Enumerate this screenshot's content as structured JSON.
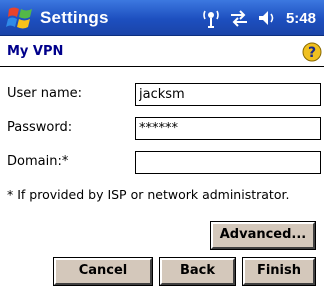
{
  "titlebar": {
    "app_title": "Settings",
    "clock": "5:48",
    "icons": [
      "windows-start-icon",
      "antenna-icon",
      "connectivity-icon",
      "speaker-icon"
    ]
  },
  "header": {
    "page_title": "My VPN",
    "help_icon": "help-icon"
  },
  "form": {
    "username_label": "User name:",
    "username_value": "jacksm",
    "password_label": "Password:",
    "password_value": "******",
    "domain_label": "Domain:*",
    "domain_value": ""
  },
  "note": "* If provided by ISP or network administrator.",
  "buttons": {
    "advanced": "Advanced...",
    "cancel": "Cancel",
    "back": "Back",
    "finish": "Finish"
  },
  "colors": {
    "titlebar": "#1d4fbf",
    "page_title": "#00008b",
    "button_face": "#d4c8bb"
  }
}
